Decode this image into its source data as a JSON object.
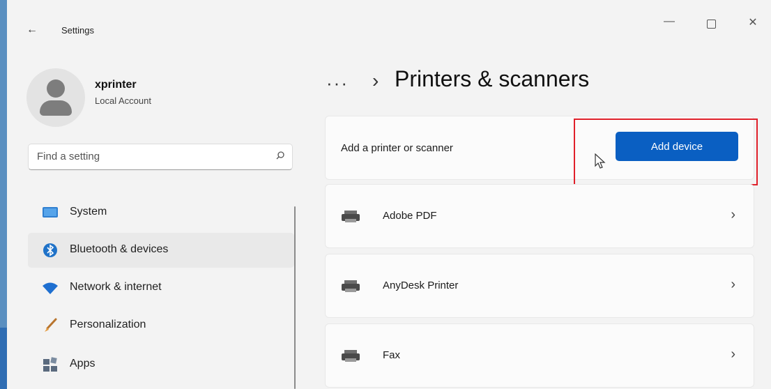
{
  "window": {
    "title": "Settings",
    "back_icon": "arrow-left-icon",
    "controls": [
      "minimize-icon",
      "maximize-icon",
      "close-icon"
    ]
  },
  "profile": {
    "name": "xprinter",
    "account_type": "Local Account"
  },
  "search": {
    "placeholder": "Find a setting",
    "value": ""
  },
  "sidebar": {
    "items": [
      {
        "label": "System",
        "icon": "system-icon",
        "active": false
      },
      {
        "label": "Bluetooth & devices",
        "icon": "bluetooth-icon",
        "active": true
      },
      {
        "label": "Network & internet",
        "icon": "wifi-icon",
        "active": false
      },
      {
        "label": "Personalization",
        "icon": "brush-icon",
        "active": false
      },
      {
        "label": "Apps",
        "icon": "apps-icon",
        "active": false
      }
    ]
  },
  "header": {
    "breadcrumb_more": "···",
    "breadcrumb_separator": "›",
    "title": "Printers & scanners"
  },
  "add_section": {
    "label": "Add a printer or scanner",
    "button_label": "Add device"
  },
  "printers": [
    {
      "name": "Adobe PDF"
    },
    {
      "name": "AnyDesk Printer"
    },
    {
      "name": "Fax"
    }
  ],
  "colors": {
    "accent": "#0a5fc2",
    "highlight": "#e0202a",
    "window_bg": "#f3f3f3"
  }
}
